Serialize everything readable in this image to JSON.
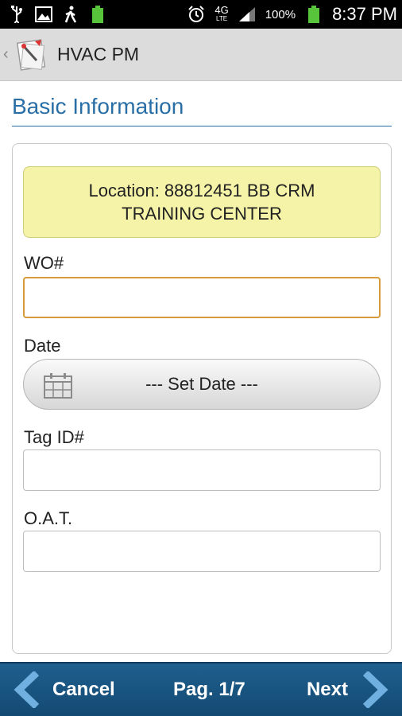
{
  "status_bar": {
    "network_label": "4G",
    "network_sub": "LTE",
    "battery_percent": "100%",
    "time": "8:37 PM",
    "icons": [
      "usb-icon",
      "image-icon",
      "walking-icon",
      "battery-charging-icon",
      "alarm-icon",
      "signal-icon",
      "battery-icon"
    ]
  },
  "app_bar": {
    "title": "HVAC PM"
  },
  "section": {
    "title": "Basic Information"
  },
  "form": {
    "location_line1": "Location: 88812451 BB CRM",
    "location_line2": "TRAINING CENTER",
    "wo_label": "WO#",
    "wo_value": "",
    "date_label": "Date",
    "date_button": "--- Set Date ---",
    "tag_label": "Tag ID#",
    "tag_value": "",
    "oat_label": "O.A.T.",
    "oat_value": ""
  },
  "bottom_nav": {
    "cancel_label": "Cancel",
    "page_label": "Pag. 1/7",
    "next_label": "Next"
  },
  "colors": {
    "accent": "#2a6ea6",
    "location_bg": "#f5f3a8",
    "focus_border": "#d89a3b",
    "nav_bg": "#1f5f8e"
  }
}
